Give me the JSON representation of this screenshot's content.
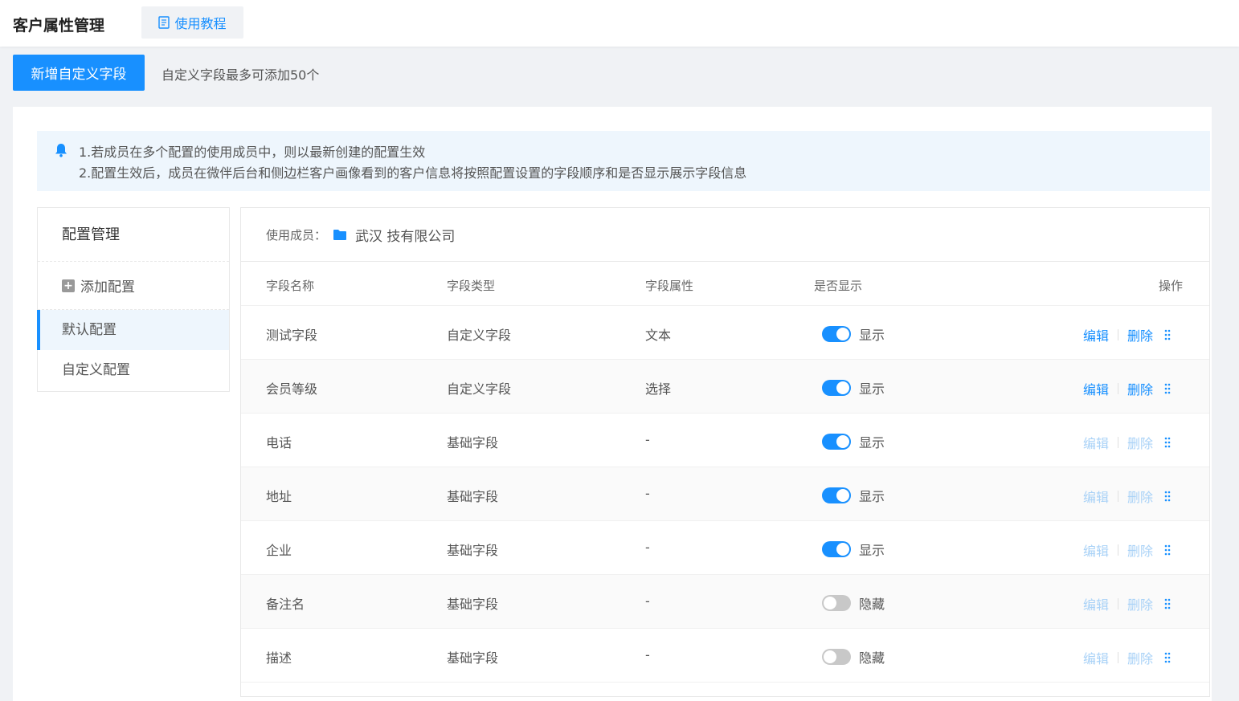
{
  "header": {
    "title": "客户属性管理",
    "tutorial_label": "使用教程"
  },
  "toolbar": {
    "add_field_label": "新增自定义字段",
    "limit_text": "自定义字段最多可添加50个"
  },
  "notice": {
    "line1": "1.若成员在多个配置的使用成员中，则以最新创建的配置生效",
    "line2": "2.配置生效后，成员在微伴后台和侧边栏客户画像看到的客户信息将按照配置设置的字段顺序和是否显示展示字段信息"
  },
  "config_panel": {
    "title": "配置管理",
    "add_label": "添加配置",
    "items": [
      {
        "label": "默认配置",
        "active": true
      },
      {
        "label": "自定义配置",
        "active": false
      }
    ]
  },
  "members": {
    "label": "使用成员：",
    "value": "武汉    技有限公司"
  },
  "table": {
    "headers": [
      "字段名称",
      "字段类型",
      "字段属性",
      "是否显示",
      "操作"
    ],
    "edit_label": "编辑",
    "delete_label": "删除",
    "rows": [
      {
        "name": "测试字段",
        "type": "自定义字段",
        "attr": "文本",
        "visible": true,
        "status": "显示",
        "editable": true
      },
      {
        "name": "会员等级",
        "type": "自定义字段",
        "attr": "选择",
        "visible": true,
        "status": "显示",
        "editable": true
      },
      {
        "name": "电话",
        "type": "基础字段",
        "attr": "-",
        "visible": true,
        "status": "显示",
        "editable": false
      },
      {
        "name": "地址",
        "type": "基础字段",
        "attr": "-",
        "visible": true,
        "status": "显示",
        "editable": false
      },
      {
        "name": "企业",
        "type": "基础字段",
        "attr": "-",
        "visible": true,
        "status": "显示",
        "editable": false
      },
      {
        "name": "备注名",
        "type": "基础字段",
        "attr": "-",
        "visible": false,
        "status": "隐藏",
        "editable": false
      },
      {
        "name": "描述",
        "type": "基础字段",
        "attr": "-",
        "visible": false,
        "status": "隐藏",
        "editable": false
      }
    ]
  },
  "colors": {
    "primary": "#1890ff",
    "primary_disabled": "#a9d2f7",
    "toggle_off": "#c8c8c8"
  }
}
